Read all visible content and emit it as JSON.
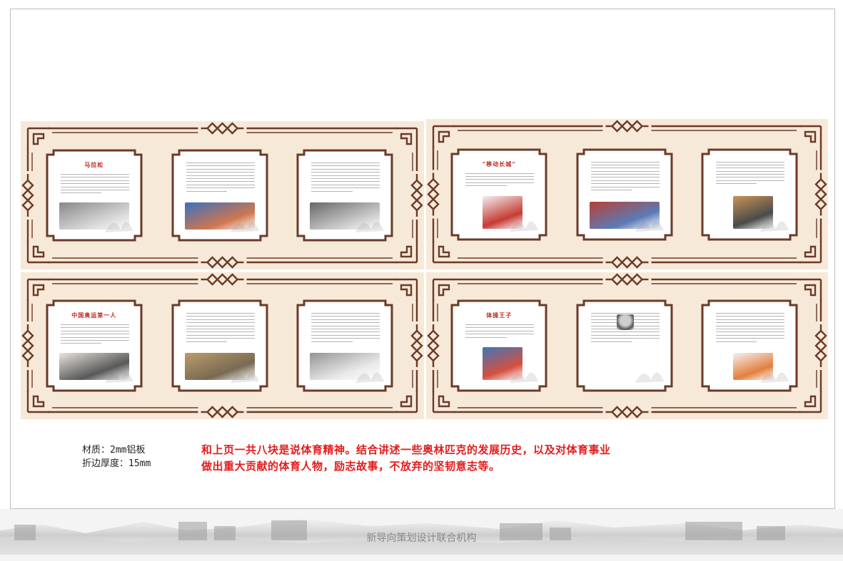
{
  "boards": [
    {
      "cards": [
        {
          "title": "马拉松",
          "photo": "marathon-runners-photo"
        },
        {
          "title": "",
          "photo": "finish-line-runner-photo"
        },
        {
          "title": "",
          "photo": "marathon-crowd-photo"
        }
      ]
    },
    {
      "cards": [
        {
          "title": "“移动长城”",
          "photo": "basketball-player-photo"
        },
        {
          "title": "",
          "photo": "basketball-player-red-jersey-photo"
        },
        {
          "title": "",
          "photo": "basketball-player-shooting-photo"
        }
      ]
    },
    {
      "cards": [
        {
          "title": "中国奥运第一人",
          "photo": "sprinter-start-photo"
        },
        {
          "title": "",
          "photo": "vintage-sprinter-photo"
        },
        {
          "title": "",
          "photo": "vintage-runner-portrait-photo"
        }
      ]
    },
    {
      "cards": [
        {
          "title": "体操王子",
          "photo": "gymnast-flag-photo"
        },
        {
          "title": "",
          "photo": "gymnast-portrait-photo"
        },
        {
          "title": "",
          "photo": "gymnast-rings-photo"
        }
      ]
    }
  ],
  "material": {
    "material_line": "材质：2mm铝板",
    "fold_line": "折边厚度：15mm"
  },
  "note": {
    "line1": "和上页一共八块是说体育精神。结合讲述一些奥林匹克的发展历史，以及对体育事业",
    "line2": "做出重大贡献的体育人物，励志故事，不放弃的坚韧意志等。"
  },
  "footer": {
    "org": "新导向策划设计联合机构"
  },
  "colors": {
    "board_bg": "#f7e9d7",
    "frame_brown": "#6b3a2a",
    "note_red": "#e41c1c"
  }
}
